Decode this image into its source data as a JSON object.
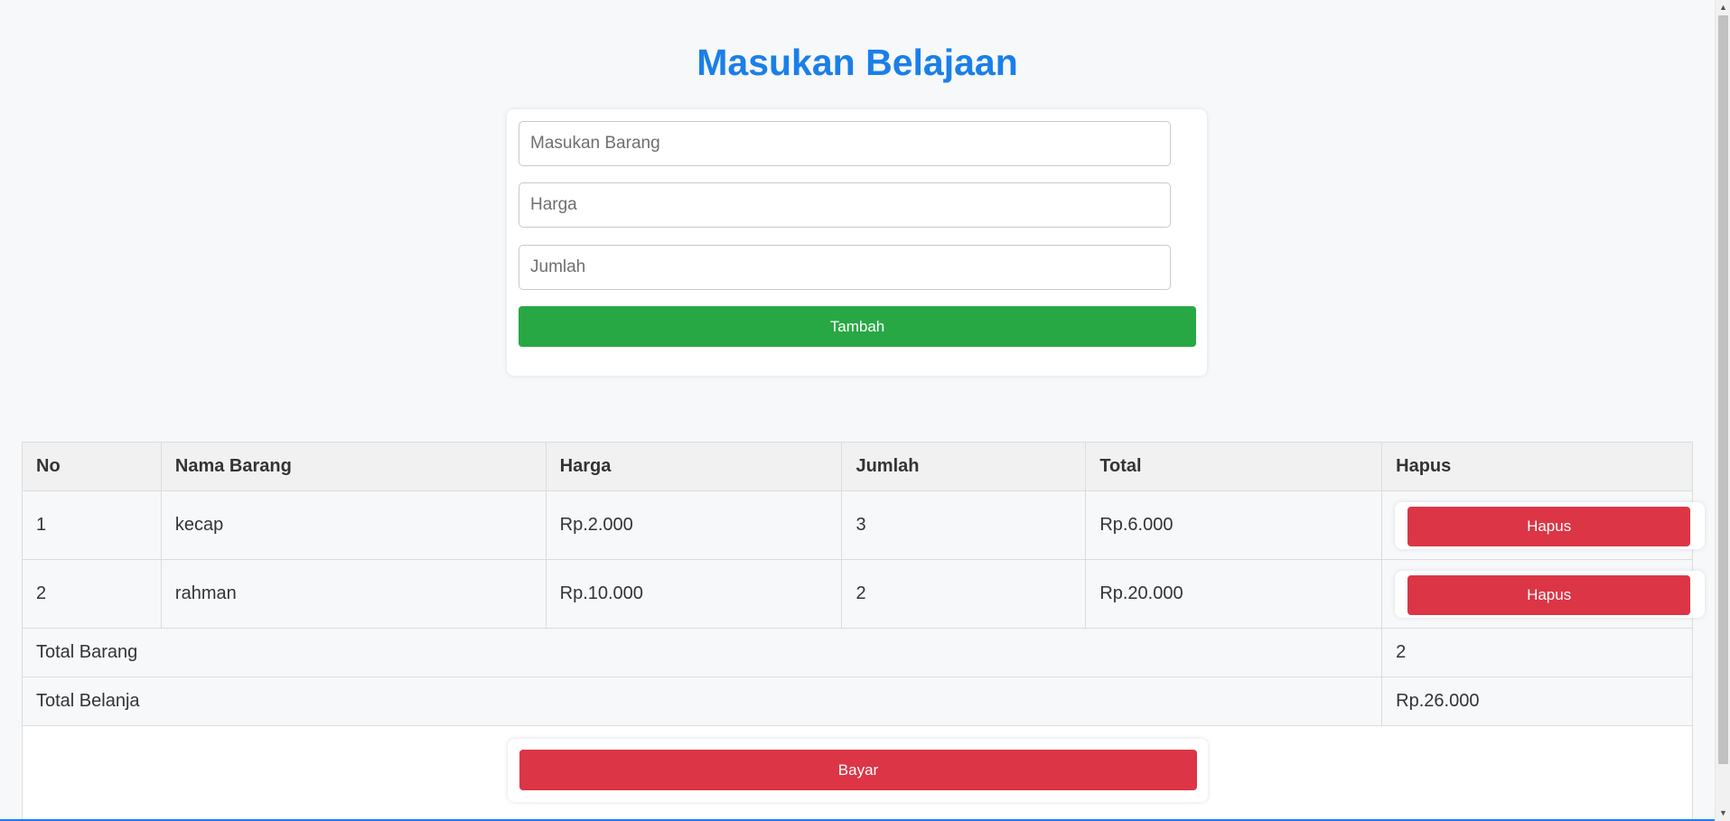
{
  "page": {
    "title": "Masukan Belajaan"
  },
  "form": {
    "item_placeholder": "Masukan Barang",
    "price_placeholder": "Harga",
    "qty_placeholder": "Jumlah",
    "item_value": "",
    "price_value": "",
    "qty_value": "",
    "add_label": "Tambah"
  },
  "table": {
    "headers": [
      "No",
      "Nama Barang",
      "Harga",
      "Jumlah",
      "Total",
      "Hapus"
    ],
    "rows": [
      {
        "no": "1",
        "name": "kecap",
        "price": "Rp.2.000",
        "qty": "3",
        "total": "Rp.6.000",
        "delete_label": "Hapus"
      },
      {
        "no": "2",
        "name": "rahman",
        "price": "Rp.10.000",
        "qty": "2",
        "total": "Rp.20.000",
        "delete_label": "Hapus"
      }
    ],
    "summary": {
      "total_items_label": "Total Barang",
      "total_items_value": "2",
      "total_spend_label": "Total Belanja",
      "total_spend_value": "Rp.26.000"
    },
    "pay_label": "Bayar"
  },
  "colors": {
    "title": "#1a7fe8",
    "add_button": "#28a745",
    "danger_button": "#dc3545",
    "background": "#f6f8fa"
  }
}
